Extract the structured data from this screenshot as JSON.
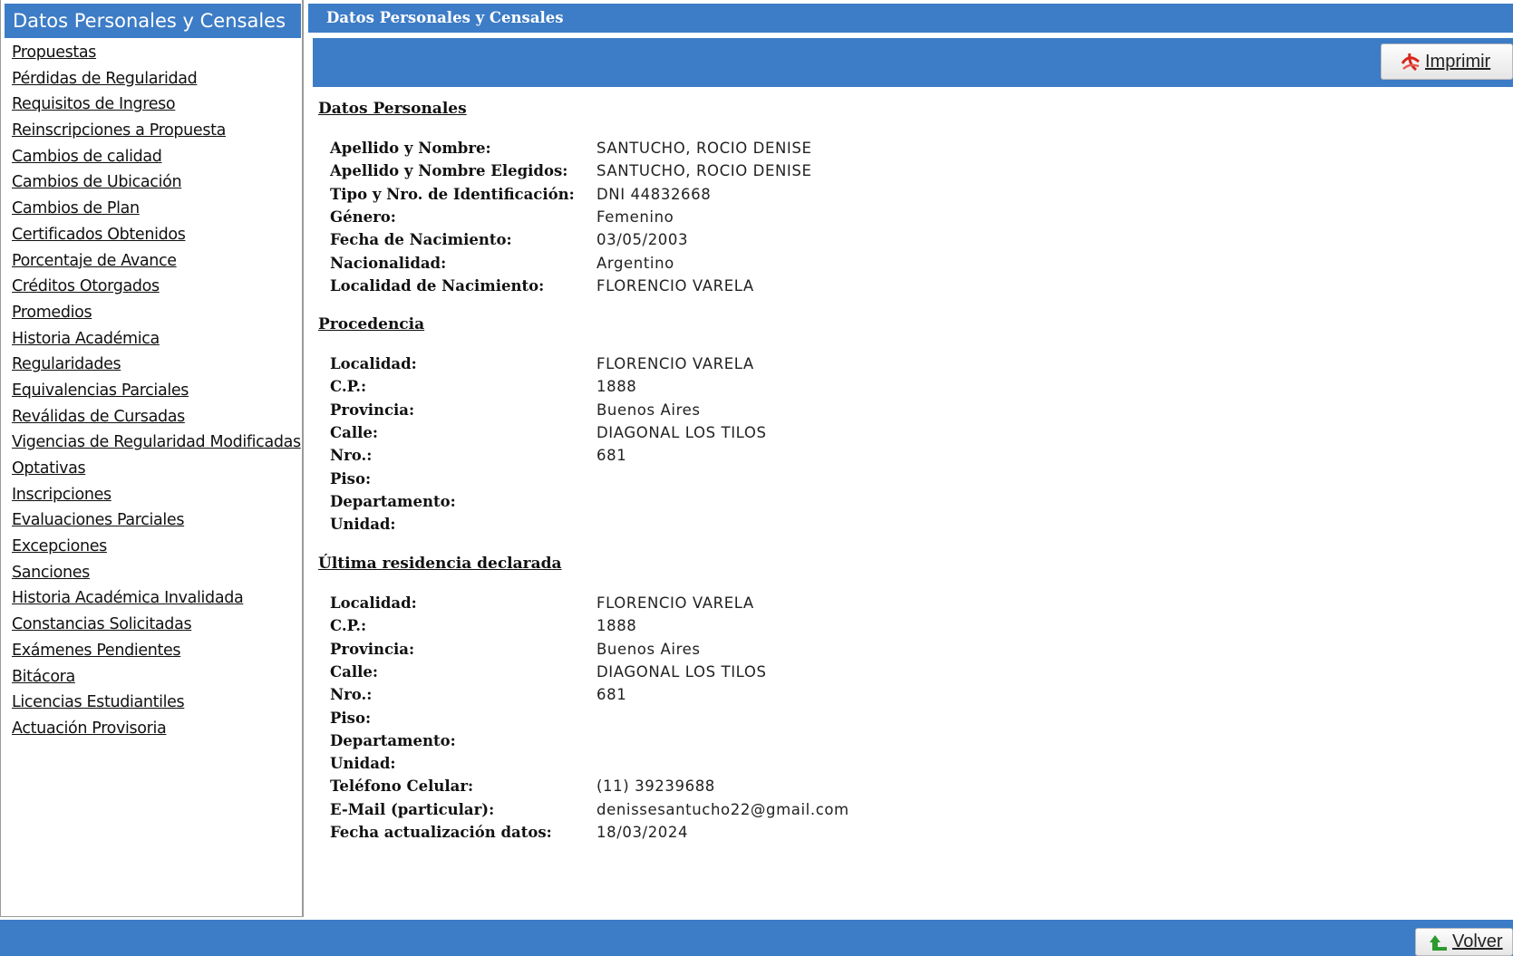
{
  "sidebar": {
    "title": "Datos Personales y Censales",
    "items": [
      {
        "label": "Propuestas"
      },
      {
        "label": "Pérdidas de Regularidad"
      },
      {
        "label": "Requisitos de Ingreso"
      },
      {
        "label": "Reinscripciones a Propuesta"
      },
      {
        "label": "Cambios de calidad"
      },
      {
        "label": "Cambios de Ubicación"
      },
      {
        "label": "Cambios de Plan"
      },
      {
        "label": "Certificados Obtenidos"
      },
      {
        "label": "Porcentaje de Avance"
      },
      {
        "label": "Créditos Otorgados"
      },
      {
        "label": "Promedios"
      },
      {
        "label": "Historia Académica"
      },
      {
        "label": "Regularidades"
      },
      {
        "label": "Equivalencias Parciales"
      },
      {
        "label": "Reválidas de Cursadas"
      },
      {
        "label": "Vigencias de Regularidad Modificadas"
      },
      {
        "label": "Optativas"
      },
      {
        "label": "Inscripciones"
      },
      {
        "label": "Evaluaciones Parciales"
      },
      {
        "label": "Excepciones"
      },
      {
        "label": "Sanciones"
      },
      {
        "label": "Historia Académica Invalidada"
      },
      {
        "label": "Constancias Solicitadas"
      },
      {
        "label": "Exámenes Pendientes"
      },
      {
        "label": "Bitácora"
      },
      {
        "label": "Licencias Estudiantiles"
      },
      {
        "label": "Actuación Provisoria"
      }
    ]
  },
  "main": {
    "title": "Datos Personales y Censales",
    "print_label": "Imprimir",
    "back_label": "Volver",
    "sections": [
      {
        "title": "Datos Personales",
        "fields": [
          {
            "label": "Apellido y Nombre:",
            "value": "SANTUCHO, ROCIO DENISE"
          },
          {
            "label": "Apellido y Nombre Elegidos:",
            "value": "SANTUCHO, ROCIO DENISE"
          },
          {
            "label": "Tipo y Nro. de Identificación:",
            "value": "DNI 44832668"
          },
          {
            "label": "Género:",
            "value": "Femenino"
          },
          {
            "label": "Fecha de Nacimiento:",
            "value": "03/05/2003"
          },
          {
            "label": "Nacionalidad:",
            "value": "Argentino"
          },
          {
            "label": "Localidad de Nacimiento:",
            "value": "FLORENCIO VARELA"
          }
        ]
      },
      {
        "title": "Procedencia",
        "fields": [
          {
            "label": "Localidad:",
            "value": "FLORENCIO VARELA"
          },
          {
            "label": "C.P.:",
            "value": "1888"
          },
          {
            "label": "Provincia:",
            "value": "Buenos Aires"
          },
          {
            "label": "Calle:",
            "value": "DIAGONAL LOS TILOS"
          },
          {
            "label": "Nro.:",
            "value": "681"
          },
          {
            "label": "Piso:",
            "value": ""
          },
          {
            "label": "Departamento:",
            "value": ""
          },
          {
            "label": "Unidad:",
            "value": ""
          }
        ]
      },
      {
        "title": "Última residencia declarada",
        "fields": [
          {
            "label": "Localidad:",
            "value": "FLORENCIO VARELA"
          },
          {
            "label": "C.P.:",
            "value": "1888"
          },
          {
            "label": "Provincia:",
            "value": "Buenos Aires"
          },
          {
            "label": "Calle:",
            "value": "DIAGONAL LOS TILOS"
          },
          {
            "label": "Nro.:",
            "value": "681"
          },
          {
            "label": "Piso:",
            "value": ""
          },
          {
            "label": "Departamento:",
            "value": ""
          },
          {
            "label": "Unidad:",
            "value": ""
          },
          {
            "label": "Teléfono Celular:",
            "value": "(11) 39239688"
          },
          {
            "label": "E-Mail (particular):",
            "value": "denissesantucho22@gmail.com"
          },
          {
            "label": "Fecha actualización datos:",
            "value": "18/03/2024"
          }
        ]
      }
    ]
  },
  "colors": {
    "header_blue": "#3d7cc6"
  },
  "icons": {
    "print": "pdf-icon",
    "back": "green-arrow-up-icon"
  }
}
